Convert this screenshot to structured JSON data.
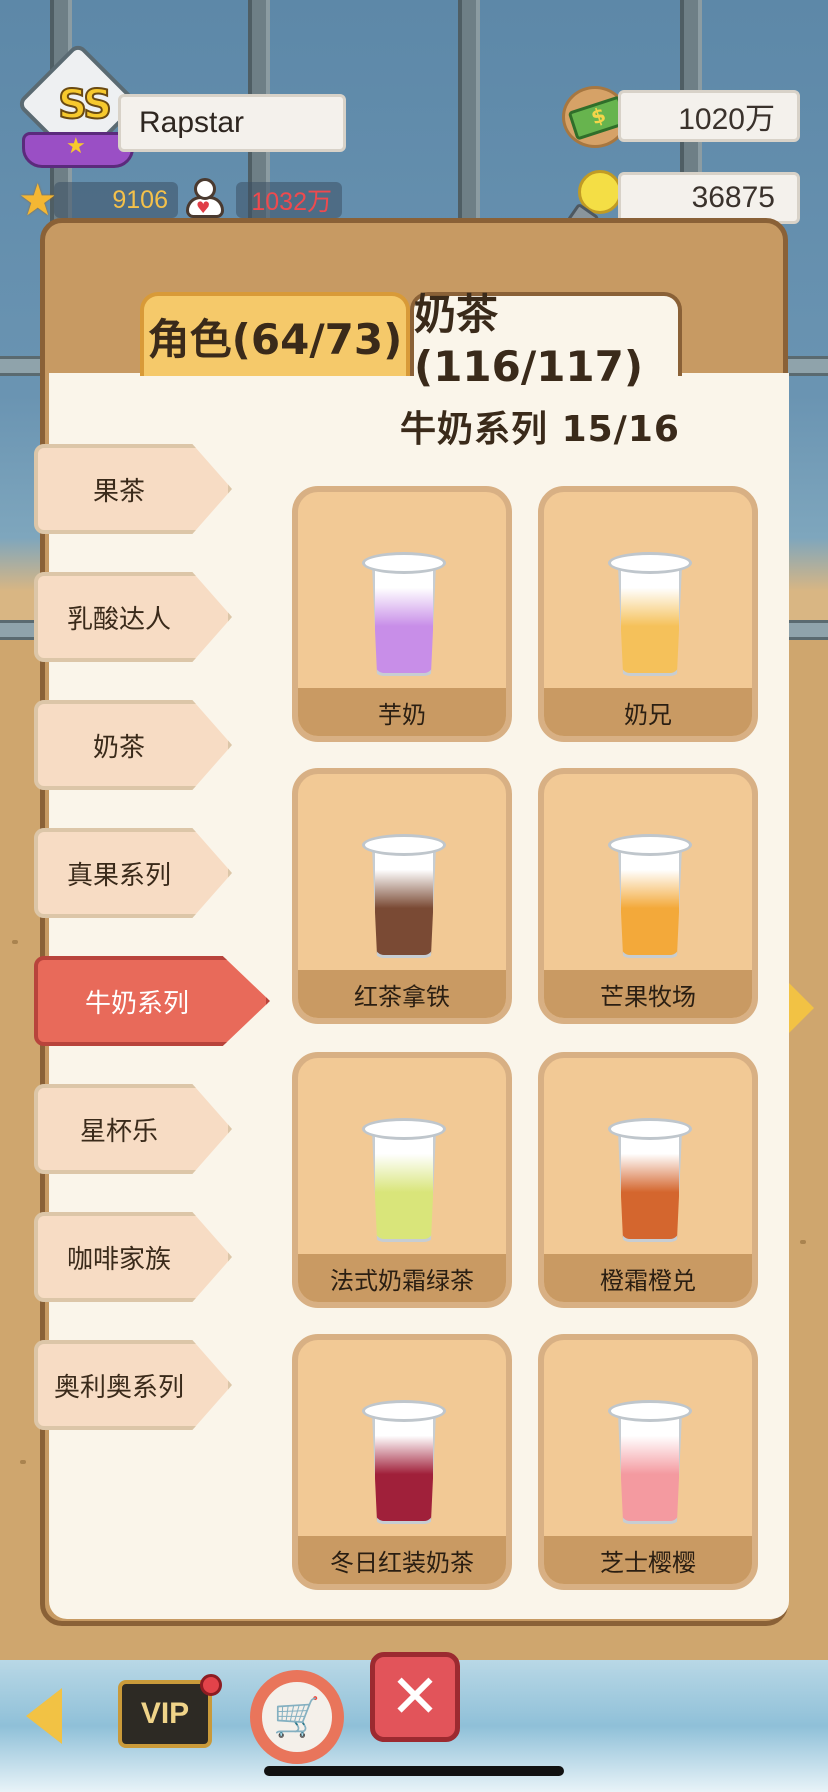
{
  "player": {
    "rank": "SS",
    "name": "Rapstar",
    "stars": "9106",
    "fans": "1032万"
  },
  "currency": {
    "money": "1020万",
    "ideas": "36875"
  },
  "tabs": [
    {
      "label": "角色(64/73)",
      "active": false
    },
    {
      "label": "奶茶(116/117)",
      "active": true
    }
  ],
  "section": {
    "title": "牛奶系列 15/16"
  },
  "categories": [
    {
      "label": "果茶",
      "active": false
    },
    {
      "label": "乳酸达人",
      "active": false
    },
    {
      "label": "奶茶",
      "active": false
    },
    {
      "label": "真果系列",
      "active": false
    },
    {
      "label": "牛奶系列",
      "active": true
    },
    {
      "label": "星杯乐",
      "active": false
    },
    {
      "label": "咖啡家族",
      "active": false
    },
    {
      "label": "奥利奥系列",
      "active": false
    }
  ],
  "drinks": [
    {
      "name": "芋奶",
      "color": "#c88ee8"
    },
    {
      "name": "奶兄",
      "color": "#f5c15a"
    },
    {
      "name": "红茶拿铁",
      "color": "#7a4a34"
    },
    {
      "name": "芒果牧场",
      "color": "#f3a93a"
    },
    {
      "name": "法式奶霜绿茶",
      "color": "#d9e57a"
    },
    {
      "name": "橙霜橙兑",
      "color": "#d4662e"
    },
    {
      "name": "冬日红装奶茶",
      "color": "#a0203a"
    },
    {
      "name": "芝士樱樱",
      "color": "#f49aa0"
    }
  ],
  "bottom_bar": {
    "vip_label": "VIP",
    "close_label": "✕"
  },
  "colors": {
    "accent_active": "#e86a5a",
    "tab_active": "#f5c96a",
    "panel": "#c79a63"
  }
}
